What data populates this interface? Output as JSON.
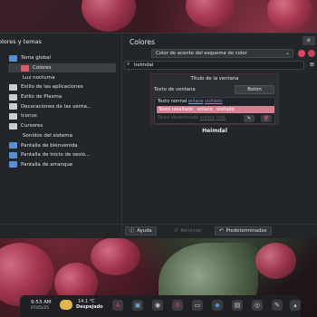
{
  "sidebar": {
    "title": "olores y temas",
    "items": [
      {
        "label": "Tema global",
        "color": "#5a8ed0"
      },
      {
        "label": "Colores",
        "color": "#d95b6b"
      },
      {
        "label": "Luz nocturna",
        "color": ""
      },
      {
        "label": "Estilo de las aplicaciones",
        "color": "#c9ced4"
      },
      {
        "label": "Estilo de Plasma",
        "color": "#c9ced4"
      },
      {
        "label": "Decoraciones de las venta...",
        "color": "#c9ced4"
      },
      {
        "label": "Iconos",
        "color": "#c9ced4"
      },
      {
        "label": "Cursores",
        "color": "#c9ced4"
      },
      {
        "label": "Sonidos del sistema",
        "color": ""
      },
      {
        "label": "Pantalla de bienvenida",
        "color": "#5a8ed0"
      },
      {
        "label": "Pantalla de inicio de sesió...",
        "color": "#5a8ed0"
      },
      {
        "label": "Pantalla de arranque",
        "color": "#5a8ed0"
      }
    ]
  },
  "header": {
    "page_title": "Colores"
  },
  "accent": {
    "label": "Color de acento del esquema de color",
    "swatches": [
      "#e0445e",
      "#c0465f"
    ]
  },
  "search": {
    "value": "heimdal",
    "glyph": "⌕",
    "menu": "≡"
  },
  "preview": {
    "window_title": "Título de la ventana",
    "text_label": "Texto de ventana",
    "button_label": "Botón",
    "normal_text": "Texto normal",
    "link": "enlace",
    "visited": "visitado",
    "selected_text": "Texto resaltado",
    "selected_link": "enlace",
    "selected_visited": "visitado",
    "disabled_text": "Texto desactivado",
    "disabled_link": "enlace",
    "disabled_visited": "visit",
    "edit_icon": "✎",
    "delete_icon": "🗑"
  },
  "scheme_name": "Heimdal",
  "footer": {
    "help": "Ayuda",
    "reset": "Reiniciar",
    "defaults": "Predeterminados"
  },
  "taskbar": {
    "time": "9:53 AM",
    "date": "07/05/25",
    "temperature": "14.1 °C",
    "weather": "Despejado"
  },
  "colors": {
    "accent": "#d5818f",
    "window_bg": "#232629",
    "selected_nav": "#3b4045"
  }
}
